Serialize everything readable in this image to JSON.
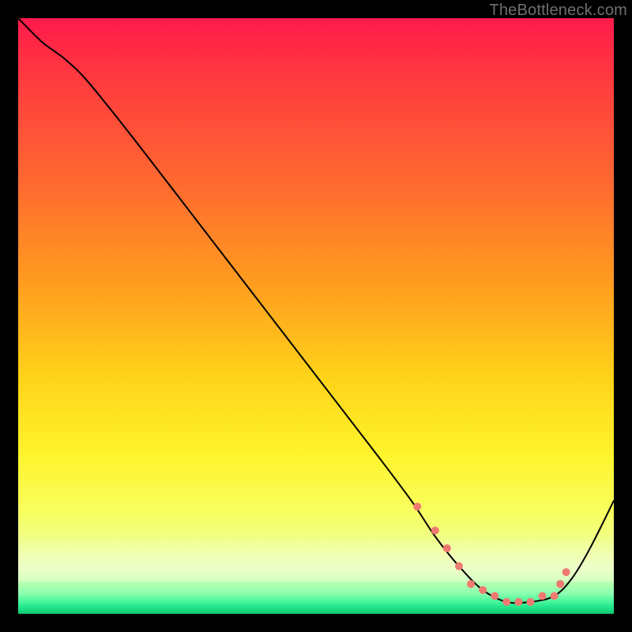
{
  "watermark": "TheBottleneck.com",
  "colors": {
    "background": "#000000",
    "gradient_top": "#ff1a4b",
    "gradient_mid": "#ffd21a",
    "gradient_bottom": "#10c76f",
    "curve": "#000000",
    "dots": "#ef7a71"
  },
  "chart_data": {
    "type": "line",
    "title": "",
    "xlabel": "",
    "ylabel": "",
    "xlim": [
      0,
      100
    ],
    "ylim": [
      0,
      100
    ],
    "grid": false,
    "legend": false,
    "series": [
      {
        "name": "bottleneck-curve",
        "x": [
          0,
          4,
          8,
          12,
          20,
          30,
          40,
          50,
          60,
          66,
          70,
          74,
          78,
          82,
          86,
          90,
          93,
          96,
          100
        ],
        "y": [
          100,
          96,
          93,
          89,
          79,
          66,
          53,
          40,
          27,
          19,
          13,
          8,
          4,
          2,
          2,
          3,
          6,
          11,
          19
        ]
      }
    ],
    "markers": [
      {
        "name": "highlight-dots",
        "x": [
          67,
          70,
          72,
          74,
          76,
          78,
          80,
          82,
          84,
          86,
          88,
          90,
          91,
          92
        ],
        "y": [
          18,
          14,
          11,
          8,
          5,
          4,
          3,
          2,
          2,
          2,
          3,
          3,
          5,
          7
        ]
      }
    ]
  }
}
